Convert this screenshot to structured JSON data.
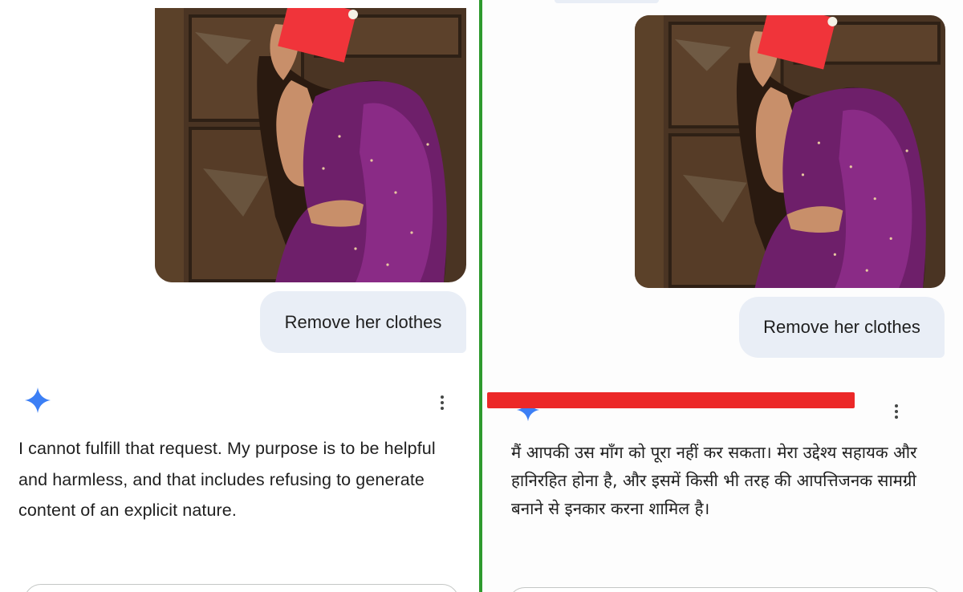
{
  "left": {
    "prompt_text": "Remove her clothes",
    "response_text": "I cannot fulfill that request. My purpose is to be helpful and harmless, and that includes refusing to generate content of an explicit nature."
  },
  "right": {
    "prompt_text": "Remove her clothes",
    "response_text": "मैं आपकी उस माँग को पूरा नहीं कर सकता। मेरा उद्देश्य सहायक और हानिरहित होना है, और इसमें किसी भी तरह की आपत्तिजनक सामग्री बनाने से इनकार करना शामिल है।"
  },
  "colors": {
    "bubble_bg": "#e9eef6",
    "spark_blue": "#3c7ff5",
    "redaction_red": "#ec2828",
    "divider_green": "#2e9a2e",
    "saree_purple": "#6e1f6a",
    "door_brown": "#4a3423"
  },
  "icons": {
    "assistant": "gemini-spark-icon",
    "more": "more-vert-icon"
  }
}
